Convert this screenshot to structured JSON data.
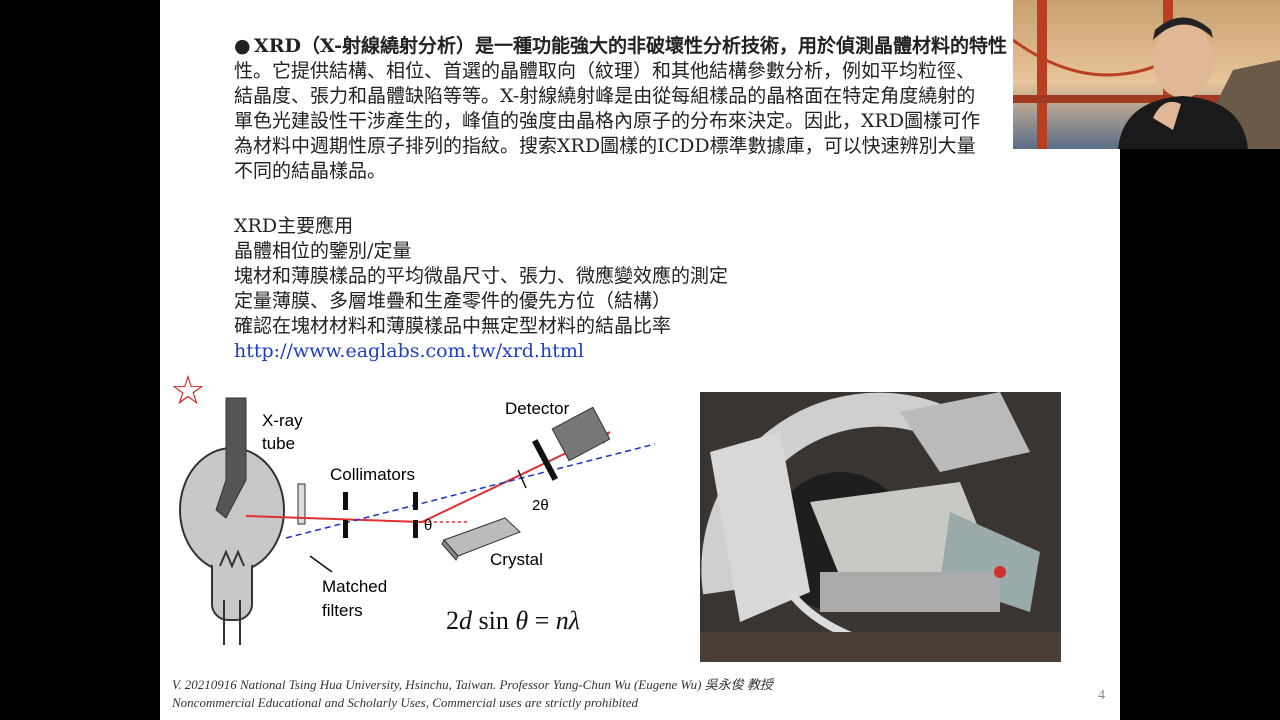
{
  "paragraph": {
    "lead": "XRD（X-射線繞射分析）是一種功能強大的非破壞性分析技術，用於偵測晶體材料的特性",
    "lines": [
      "性。它提供結構、相位、首選的晶體取向（紋理）和其他結構參數分析，例如平均粒徑、",
      "結晶度、張力和晶體缺陷等等。X-射線繞射峰是由從每組樣品的晶格面在特定角度繞射的",
      "單色光建設性干涉產生的，峰值的強度由晶格內原子的分布來決定。因此，XRD圖樣可作",
      "為材料中週期性原子排列的指紋。搜索XRD圖樣的ICDD標準數據庫，可以快速辨別大量",
      "不同的結晶樣品。"
    ]
  },
  "applications": {
    "heading": "XRD主要應用",
    "items": [
      "晶體相位的鑒別/定量",
      "塊材和薄膜樣品的平均微晶尺寸、張力、微應變效應的測定",
      "定量薄膜、多層堆疊和生產零件的優先方位（結構）",
      "確認在塊材材料和薄膜樣品中無定型材料的結晶比率"
    ],
    "link": "http://www.eaglabs.com.tw/xrd.html"
  },
  "diagram": {
    "xray_tube_line1": "X-ray",
    "xray_tube_line2": "tube",
    "collimators": "Collimators",
    "detector": "Detector",
    "theta": "θ",
    "two_theta": "2θ",
    "crystal": "Crystal",
    "matched_line1": "Matched",
    "matched_line2": "filters",
    "star": "☆"
  },
  "formula": {
    "parts": [
      "2",
      "d",
      " sin ",
      "θ",
      " = ",
      "n",
      "λ"
    ]
  },
  "footer": {
    "line1": "V. 20210916 National Tsing Hua University, Hsinchu, Taiwan. Professor Yung-Chun Wu (Eugene Wu) 吳永俊 教授",
    "line2": "Noncommercial Educational and Scholarly Uses, Commercial uses are strictly prohibited"
  },
  "page_number": "4",
  "colors": {
    "beam": "#e23030",
    "dashed_line": "#2030c0",
    "star": "#d02020",
    "link": "#1f3fbf",
    "tube_fill": "#c8c8c8"
  },
  "icons": {
    "webcam": "presenter-webcam-video",
    "photo": "xrd-instrument-photo"
  }
}
